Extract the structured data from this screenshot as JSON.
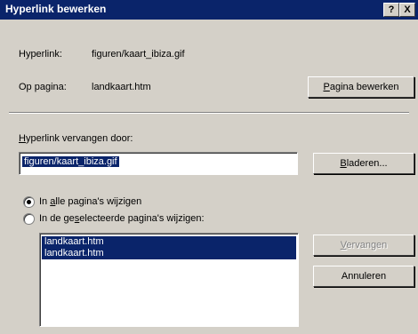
{
  "window": {
    "title": "Hyperlink bewerken",
    "help_label": "?",
    "close_label": "X"
  },
  "info": {
    "hyperlink_label": "Hyperlink:",
    "hyperlink_value": "figuren/kaart_ibiza.gif",
    "page_label": "Op pagina:",
    "page_value": "landkaart.htm"
  },
  "buttons": {
    "edit_page_pre": "P",
    "edit_page_rest": "agina bewerken",
    "browse_pre": "B",
    "browse_rest": "laderen...",
    "replace_pre": "V",
    "replace_rest": "ervangen",
    "cancel": "Annuleren"
  },
  "replace": {
    "label_pre": "H",
    "label_rest": "yperlink vervangen door:",
    "value": "figuren/kaart_ibiza.gif"
  },
  "radios": {
    "all_pre": "In ",
    "all_acc": "a",
    "all_rest": "lle pagina's wijzigen",
    "selected_pre": "In de ge",
    "selected_acc": "s",
    "selected_rest": "electeerde pagina's wijzigen:"
  },
  "pages": [
    "landkaart.htm",
    "landkaart.htm"
  ]
}
